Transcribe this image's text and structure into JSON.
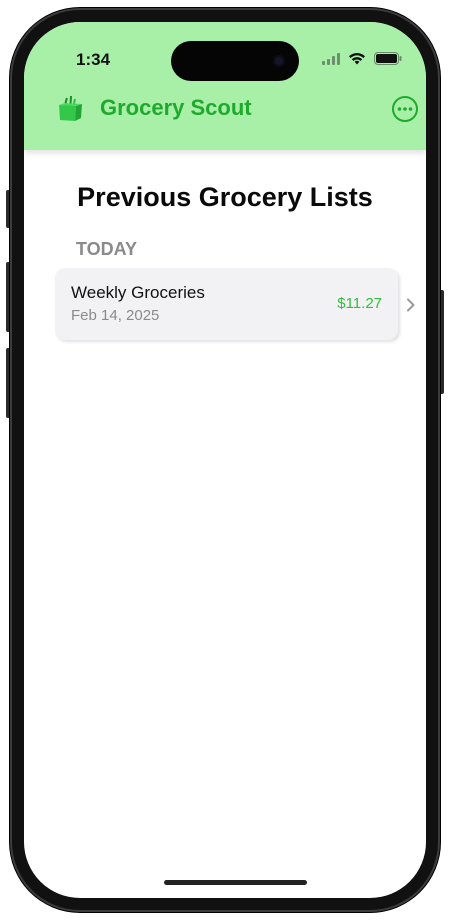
{
  "status_bar": {
    "time": "1:34"
  },
  "header": {
    "app_title": "Grocery Scout",
    "logo_icon": "grocery-bag-icon",
    "more_icon": "ellipsis-circle-icon",
    "background_color": "#a8f0a8",
    "title_color": "#1faa2d"
  },
  "main": {
    "page_title": "Previous Grocery Lists",
    "sections": [
      {
        "header": "TODAY",
        "items": [
          {
            "name": "Weekly Groceries",
            "date": "Feb 14, 2025",
            "total": "$11.27"
          }
        ]
      }
    ]
  },
  "colors": {
    "accent_green": "#2fbe3f",
    "card_background": "#f2f2f4"
  }
}
